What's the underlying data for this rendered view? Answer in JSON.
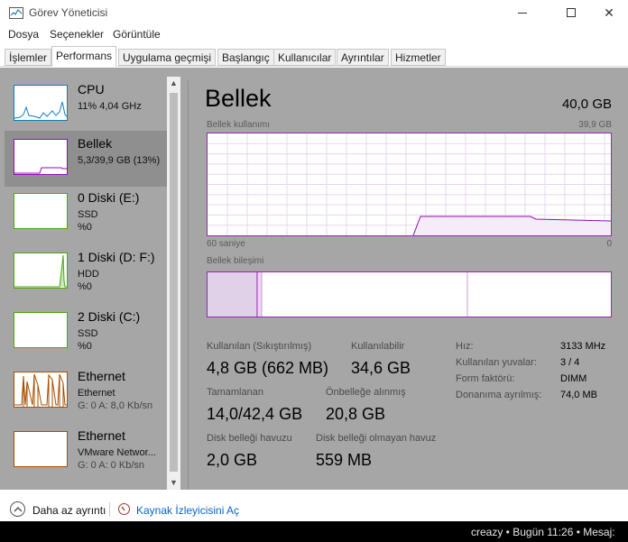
{
  "window": {
    "title": "Görev Yöneticisi",
    "controls": {
      "minimize": "—",
      "maximize": "☐",
      "close": "✕"
    }
  },
  "menu": [
    "Dosya",
    "Seçenekler",
    "Görüntüle"
  ],
  "tabs": [
    {
      "label": "İşlemler",
      "active": false
    },
    {
      "label": "Performans",
      "active": true
    },
    {
      "label": "Uygulama geçmişi",
      "active": false
    },
    {
      "label": "Başlangıç",
      "active": false
    },
    {
      "label": "Kullanıcılar",
      "active": false
    },
    {
      "label": "Ayrıntılar",
      "active": false
    },
    {
      "label": "Hizmetler",
      "active": false
    }
  ],
  "sidebar": {
    "items": [
      {
        "title": "CPU",
        "line1": "11% 4,04 GHz",
        "line2": "",
        "color": "#117dbb",
        "selected": false
      },
      {
        "title": "Bellek",
        "line1": "5,3/39,9 GB (13%)",
        "line2": "",
        "color": "#8b12ae",
        "selected": true
      },
      {
        "title": "0 Diski (E:)",
        "line1": "SSD",
        "line2": "%0",
        "color": "#4da60c",
        "selected": false
      },
      {
        "title": "1 Diski (D: F:)",
        "line1": "HDD",
        "line2": "%0",
        "color": "#4da60c",
        "selected": false
      },
      {
        "title": "2 Diski (C:)",
        "line1": "SSD",
        "line2": "%0",
        "color": "#4da60c",
        "selected": false
      },
      {
        "title": "Ethernet",
        "line1": "Ethernet",
        "line2": "G: 0 A: 8,0 Kb/sn",
        "color": "#a74f01",
        "selected": false
      },
      {
        "title": "Ethernet",
        "line1": "VMware Networ...",
        "line2": "G: 0 A: 0 Kb/sn",
        "color": "#a74f01",
        "selected": false
      }
    ]
  },
  "memory": {
    "title": "Bellek",
    "total": "40,0 GB",
    "usage_label": "Bellek kullanımı",
    "usage_max": "39,9 GB",
    "time_left": "60 saniye",
    "time_right": "0",
    "composition_label": "Bellek bileşimi",
    "accent_color": "#8b12ae",
    "stats": {
      "in_use_label": "Kullanılan (Sıkıştırılmış)",
      "in_use_value": "4,8 GB (662 MB)",
      "available_label": "Kullanılabilir",
      "available_value": "34,6 GB",
      "committed_label": "Tamamlanan",
      "committed_value": "14,0/42,4 GB",
      "cached_label": "Önbelleğe alınmış",
      "cached_value": "20,8 GB",
      "paged_label": "Disk belleği havuzu",
      "paged_value": "2,0 GB",
      "nonpaged_label": "Disk belleği olmayan havuz",
      "nonpaged_value": "559 MB"
    },
    "details": [
      {
        "label": "Hız:",
        "value": "3133 MHz"
      },
      {
        "label": "Kullanılan yuvalar:",
        "value": "3 / 4"
      },
      {
        "label": "Form faktörü:",
        "value": "DIMM"
      },
      {
        "label": "Donanıma ayrılmış:",
        "value": "74,0 MB"
      }
    ]
  },
  "footer": {
    "fewer_details": "Daha az ayrıntı",
    "resource_monitor": "Kaynak İzleyicisini Aç"
  },
  "taskbar": {
    "text": "creazy • Bugün 11:26 • Mesaj:"
  }
}
